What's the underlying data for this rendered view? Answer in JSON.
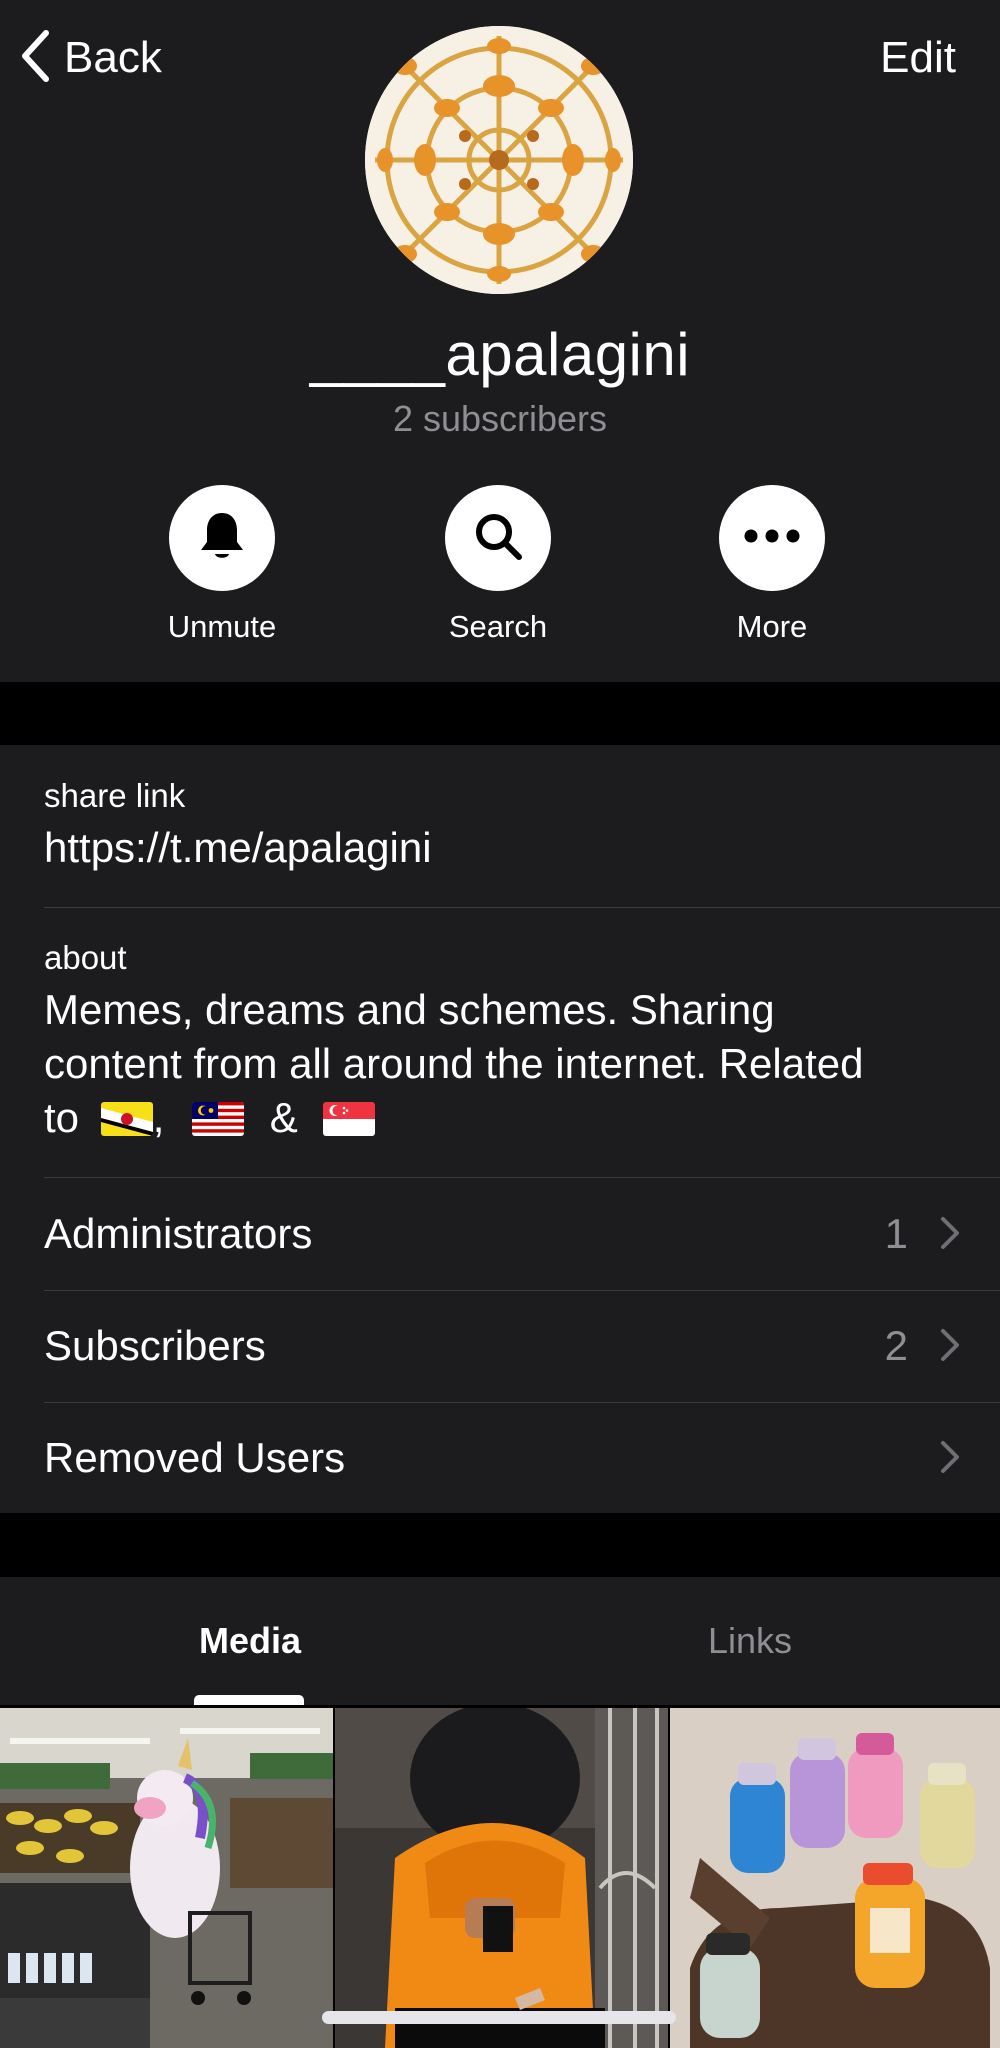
{
  "nav": {
    "back_label": "Back",
    "edit_label": "Edit"
  },
  "channel": {
    "name": "____apalagini",
    "subscribers_text": "2 subscribers"
  },
  "actions": [
    {
      "label": "Unmute",
      "icon": "bell-icon"
    },
    {
      "label": "Search",
      "icon": "search-icon"
    },
    {
      "label": "More",
      "icon": "more-icon"
    }
  ],
  "info": {
    "share_link": {
      "caption": "share link",
      "value": "https://t.me/apalagini"
    },
    "about": {
      "caption": "about",
      "line1": "Memes, dreams and schemes. Sharing",
      "line2": "content from all around the internet. Related",
      "line3_prefix": "to",
      "sep_comma": ",",
      "sep_amp": "&",
      "flags": [
        "brunei-flag-icon",
        "malaysia-flag-icon",
        "singapore-flag-icon"
      ]
    }
  },
  "rows": [
    {
      "title": "Administrators",
      "count": "1"
    },
    {
      "title": "Subscribers",
      "count": "2"
    },
    {
      "title": "Removed Users",
      "count": ""
    }
  ],
  "tabs": [
    {
      "label": "Media",
      "active": true
    },
    {
      "label": "Links",
      "active": false
    }
  ],
  "media": [
    {
      "name": "supermarket-unicorn-thumbnail"
    },
    {
      "name": "orange-jacket-person-thumbnail"
    },
    {
      "name": "sanitizer-glove-thumbnail"
    }
  ],
  "colors": {
    "background": "#000000",
    "surface": "#1c1c1e",
    "secondary_text": "#8e8e93",
    "divider": "#3a3a3c",
    "primary_text": "#ffffff"
  }
}
